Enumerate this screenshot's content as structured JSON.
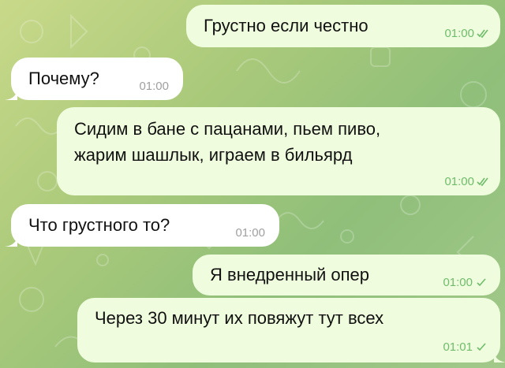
{
  "chat": {
    "messages": [
      {
        "id": "m1",
        "direction": "outgoing",
        "text": "Грустно если честно",
        "time": "01:00",
        "status": "read"
      },
      {
        "id": "m2",
        "direction": "incoming",
        "text": "Почему?",
        "time": "01:00"
      },
      {
        "id": "m3",
        "direction": "outgoing",
        "text": "Сидим в бане с пацанами, пьем пиво,\nжарим шашлык, играем в бильярд",
        "time": "01:00",
        "status": "read"
      },
      {
        "id": "m4",
        "direction": "incoming",
        "text": "Что грустного то?",
        "time": "01:00"
      },
      {
        "id": "m5",
        "direction": "outgoing",
        "text": "Я внедренный опер",
        "time": "01:00",
        "status": "sent"
      },
      {
        "id": "m6",
        "direction": "outgoing",
        "text": "Через 30 минут их повяжут тут всех",
        "time": "01:01",
        "status": "sent"
      }
    ]
  },
  "colors": {
    "incoming_bubble": "#ffffff",
    "outgoing_bubble": "#effdde",
    "tick_color": "#6fbd6b",
    "wallpaper_start": "#c9d98a",
    "wallpaper_end": "#8fbf7a"
  },
  "icons": {
    "read_status": "double-check-icon",
    "sent_status": "check-icon"
  }
}
